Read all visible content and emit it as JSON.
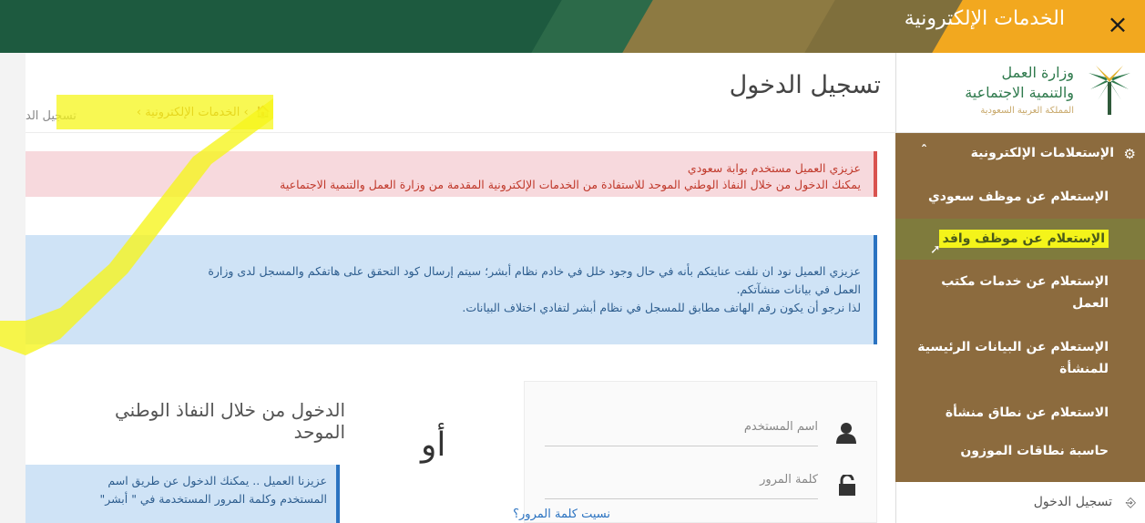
{
  "topbar": {
    "title": "الخدمات الإلكترونية",
    "close_icon": "×"
  },
  "sidebar": {
    "logo": {
      "line1": "وزارة العمل",
      "line2": "والتنمية الاجتماعية",
      "line3": "المملكة العربية السعودية"
    },
    "menu_header": {
      "label": "الإستعلامات الإلكترونية",
      "caret": "ˆ"
    },
    "items": [
      {
        "label": "الإستعلام عن موظف سعودي"
      },
      {
        "label": "الإستعلام عن موظف وافد"
      },
      {
        "label": "الإستعلام عن خدمات مكتب العمل"
      },
      {
        "label": "الإستعلام عن البيانات الرئيسية للمنشأة"
      },
      {
        "label": "الاستعلام عن نطاق منشأة"
      },
      {
        "label": "حاسبة نطاقات الموزون"
      }
    ],
    "login_link": "تسجيل الدخول"
  },
  "main": {
    "title": "تسجيل الدخول",
    "breadcrumb": {
      "home_icon": "🏠",
      "crumb1": "الخدمات الإلكترونية",
      "crumb2": "تسجيل الد"
    },
    "alert_red": {
      "line1": "عزيزي العميل مستخدم بوابة سعودي",
      "line2": "يمكنك الدخول من خلال النفاذ الوطني الموحد للاستفادة من الخدمات الإلكترونية المقدمة من وزارة العمل والتنمية الاجتماعية"
    },
    "alert_blue": {
      "line1": "عزيزي العميل نود ان نلفت عنايتكم بأنه في حال وجود خلل في خادم نظام أبشر؛ سيتم إرسال كود التحقق على هاتفكم والمسجل لدى وزارة",
      "line2": "العمل في بيانات منشآتكم.",
      "line3": "لذا نرجو أن يكون رقم الهاتف مطابق للمسجل في نظام أبشر لتفادي اختلاف البيانات."
    },
    "form": {
      "username_label": "اسم المستخدم",
      "password_label": "كلمة المرور",
      "forgot": "نسيت كلمة المرور؟"
    },
    "or_label": "أو",
    "nafath": {
      "title_line1": "الدخول من خلال النفاذ الوطني",
      "title_line2": "الموحد",
      "box_line1": "عزيزنا العميل .. يمكنك الدخول عن طريق اسم",
      "box_line2": "المستخدم وكلمة المرور المستخدمة في \" أبشر\""
    }
  }
}
